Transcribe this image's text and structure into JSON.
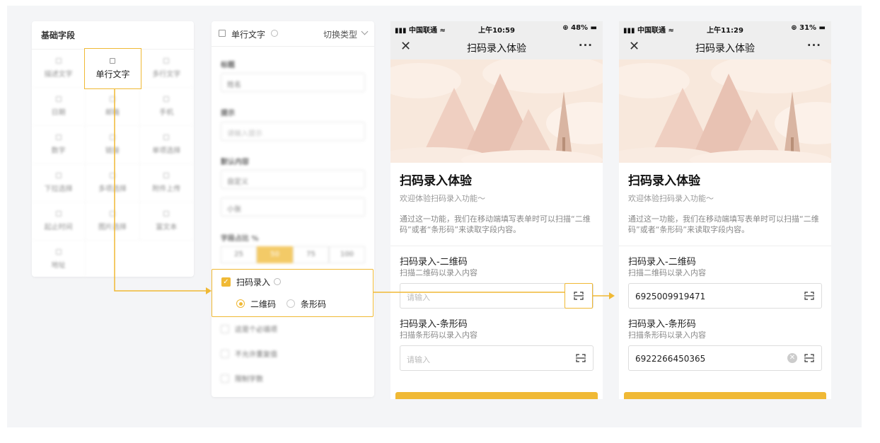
{
  "fields_panel": {
    "title": "基础字段",
    "items": [
      {
        "label": "描述文字"
      },
      {
        "label": "单行文字"
      },
      {
        "label": "多行文字"
      },
      {
        "label": "日期"
      },
      {
        "label": "邮箱"
      },
      {
        "label": "手机"
      },
      {
        "label": "数字"
      },
      {
        "label": "链接"
      },
      {
        "label": "单项选择"
      },
      {
        "label": "下拉选择"
      },
      {
        "label": "多项选择"
      },
      {
        "label": "附件上传"
      },
      {
        "label": "起止时间"
      },
      {
        "label": "图片选择"
      },
      {
        "label": "富文本"
      },
      {
        "label": "地址"
      }
    ]
  },
  "props_panel": {
    "title": "单行文字",
    "switch_type": "切换类型",
    "label_title": "标题",
    "title_value": "姓名",
    "label_hint": "提示",
    "hint_value": "请输入提示",
    "label_default": "默认内容",
    "default_select": "自定义",
    "default_value": "小张",
    "label_width": "字段占比 %",
    "width_options": [
      "25",
      "50",
      "75",
      "100"
    ],
    "scan_label": "扫码录入",
    "scan_options": [
      "二维码",
      "条形码"
    ],
    "checks": [
      "这是个必填项",
      "不允许重复值",
      "限制字数"
    ]
  },
  "phone1": {
    "carrier": "中国联通",
    "time": "上午10:59",
    "battery": "48%",
    "nav_title": "扫码录入体验",
    "close_glyph": "✕",
    "more_glyph": "···",
    "heading": "扫码录入体验",
    "subtitle": "欢迎体验扫码录入功能～",
    "description": "通过这一功能，我们在移动端填写表单时可以扫描“二维码”或者“条形码”来读取字段内容。",
    "qr_title": "扫码录入-二维码",
    "qr_sub": "扫描二维码以录入内容",
    "qr_placeholder": "请输入",
    "bar_title": "扫码录入-条形码",
    "bar_sub": "扫描条形码以录入内容",
    "bar_placeholder": "请输入"
  },
  "phone2": {
    "carrier": "中国联通",
    "time": "上午11:29",
    "battery": "31%",
    "nav_title": "扫码录入体验",
    "close_glyph": "✕",
    "more_glyph": "···",
    "heading": "扫码录入体验",
    "subtitle": "欢迎体验扫码录入功能～",
    "description": "通过这一功能，我们在移动端填写表单时可以扫描“二维码”或者“条形码”来读取字段内容。",
    "qr_title": "扫码录入-二维码",
    "qr_sub": "扫描二维码以录入内容",
    "qr_value": "6925009919471",
    "bar_title": "扫码录入-条形码",
    "bar_sub": "扫描条形码以录入内容",
    "bar_value": "6922266450365"
  },
  "colors": {
    "accent": "#f0b935",
    "canvas": "#f4f5f7"
  }
}
